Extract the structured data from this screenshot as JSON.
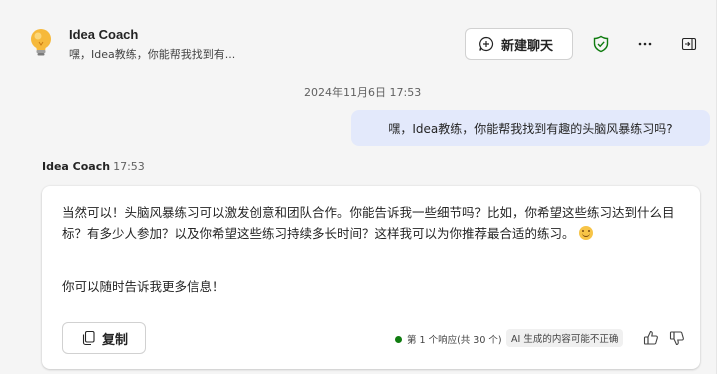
{
  "header": {
    "title": "Idea Coach",
    "subtitle": "嘿，Idea教练，你能帮我找到有...",
    "new_chat_label": "新建聊天"
  },
  "conversation": {
    "timestamp": "2024年11月6日 17:53",
    "user_message": "嘿，Idea教练，你能帮我找到有趣的头脑风暴练习吗?",
    "bot_name": "Idea Coach",
    "bot_time": "17:53",
    "bot_paragraph_1": "当然可以！头脑风暴练习可以激发创意和团队合作。你能告诉我一些细节吗？比如，你希望这些练习达到什么目标？有多少人参加？以及你希望这些练习持续多长时间？这样我可以为你推荐最合适的练习。",
    "bot_paragraph_2": "你可以随时告诉我更多信息！",
    "copy_label": "复制",
    "response_count": "第 1 个响应(共 30 个)",
    "ai_disclaimer": "AI 生成的内容可能不正确"
  },
  "icons": {
    "bot_avatar": "lightbulb-icon",
    "new_chat": "chat-add-icon",
    "shield": "shield-check-icon",
    "more": "more-horizontal-icon",
    "sidebar": "panel-collapse-icon",
    "copy": "copy-icon",
    "thumbs_up": "thumbs-up-icon",
    "thumbs_down": "thumbs-down-icon"
  },
  "colors": {
    "user_bubble": "#e3e9fb",
    "status_green": "#107c10",
    "bulb_yellow": "#f6b93b"
  }
}
